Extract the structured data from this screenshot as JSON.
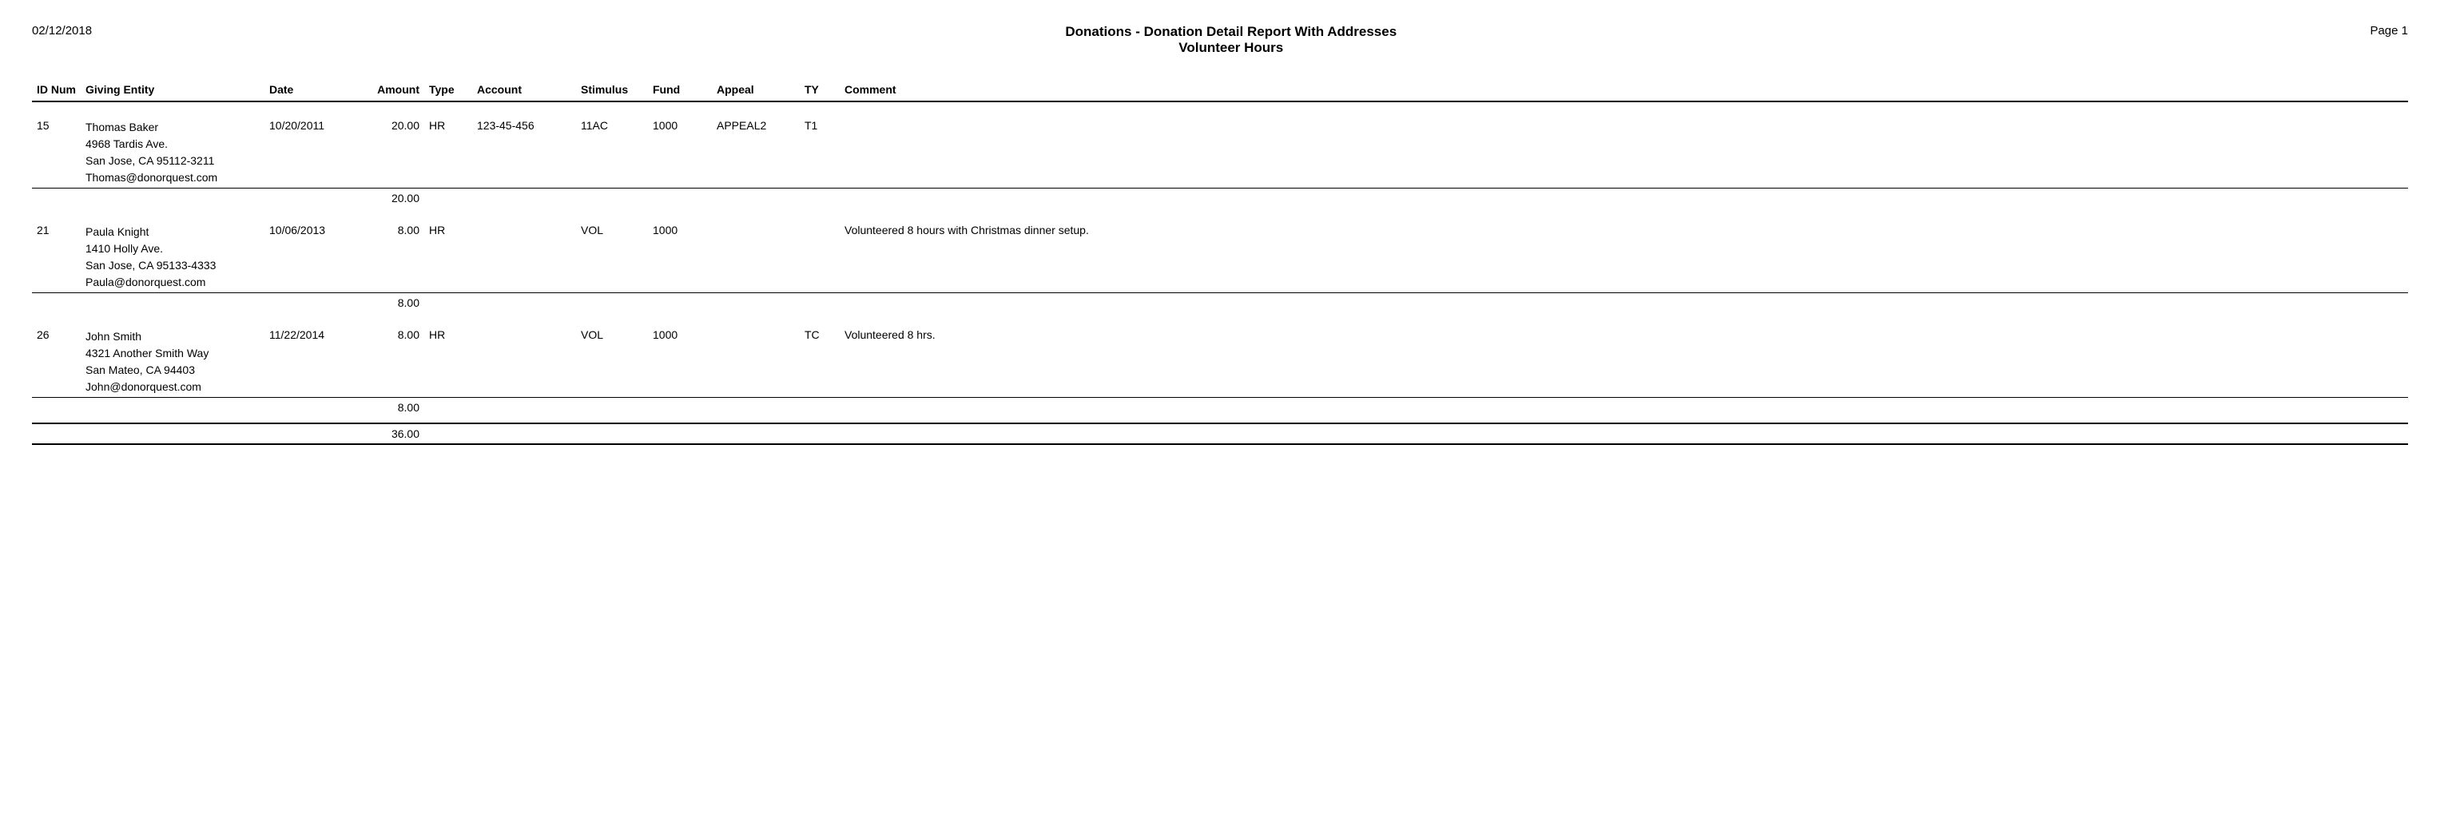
{
  "header": {
    "date": "02/12/2018",
    "main_title": "Donations - Donation Detail Report With Addresses",
    "sub_title": "Volunteer Hours",
    "page": "Page 1"
  },
  "columns": {
    "id_num": "ID Num",
    "giving_entity": "Giving Entity",
    "date": "Date",
    "amount": "Amount",
    "type": "Type",
    "account": "Account",
    "stimulus": "Stimulus",
    "fund": "Fund",
    "appeal": "Appeal",
    "ty": "TY",
    "comment": "Comment"
  },
  "rows": [
    {
      "id": "15",
      "name": "Thomas Baker",
      "address1": "4968 Tardis Ave.",
      "address2": "San Jose, CA  95112-3211",
      "email": "Thomas@donorquest.com",
      "date": "10/20/2011",
      "amount": "20.00",
      "subtotal": "20.00",
      "type": "HR",
      "account": "123-45-456",
      "stimulus": "11AC",
      "fund": "1000",
      "appeal": "APPEAL2",
      "ty": "T1",
      "comment": ""
    },
    {
      "id": "21",
      "name": "Paula Knight",
      "address1": "1410 Holly Ave.",
      "address2": "San Jose, CA  95133-4333",
      "email": "Paula@donorquest.com",
      "date": "10/06/2013",
      "amount": "8.00",
      "subtotal": "8.00",
      "type": "HR",
      "account": "",
      "stimulus": "VOL",
      "fund": "1000",
      "appeal": "",
      "ty": "",
      "comment": "Volunteered 8 hours with Christmas dinner setup."
    },
    {
      "id": "26",
      "name": "John Smith",
      "address1": "4321 Another Smith Way",
      "address2": "San Mateo, CA  94403",
      "email": "John@donorquest.com",
      "date": "11/22/2014",
      "amount": "8.00",
      "subtotal": "8.00",
      "type": "HR",
      "account": "",
      "stimulus": "VOL",
      "fund": "1000",
      "appeal": "",
      "ty": "TC",
      "comment": "Volunteered 8 hrs."
    }
  ],
  "grand_total": "36.00"
}
